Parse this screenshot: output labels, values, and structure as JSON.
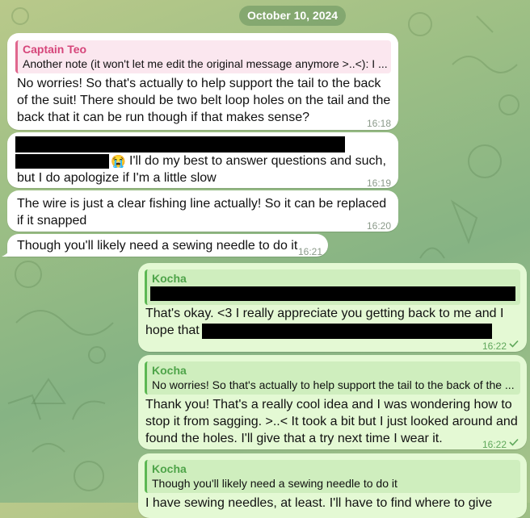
{
  "date_separator": "October 10, 2024",
  "messages": [
    {
      "sender": "incoming",
      "reply_to": {
        "name": "Captain Teo",
        "quote": "Another note (it won't let me edit the original message anymore >..<): I ..."
      },
      "lines": [
        "No worries! So that's actually to help support the tail to the back",
        "of the suit! There should be two belt loop holes on the tail and the",
        "back that it can be run though if that makes sense?"
      ],
      "time": "16:18"
    },
    {
      "sender": "incoming",
      "emoji": "😭",
      "lines": [
        "I'll do my best to answer questions and such,",
        "but I do apologize if I'm a little slow"
      ],
      "time": "16:19"
    },
    {
      "sender": "incoming",
      "lines": [
        "The wire is just a clear fishing line actually! So it can be replaced",
        "if it snapped"
      ],
      "time": "16:20"
    },
    {
      "sender": "incoming",
      "lines": [
        "Though you'll likely need a sewing needle to do it"
      ],
      "time": "16:21"
    },
    {
      "sender": "outgoing",
      "reply_to": {
        "name": "Kocha",
        "quote": ""
      },
      "lines": [
        "That's okay. <3 I really appreciate you getting back to me and I",
        "hope that"
      ],
      "time": "16:22"
    },
    {
      "sender": "outgoing",
      "reply_to": {
        "name": "Kocha",
        "quote": "No worries! So that's actually to help support the tail to the back of the ..."
      },
      "lines": [
        "Thank you! That's a really cool idea and I was wondering how to",
        "stop it from sagging. >..< It took a bit but I just looked around and",
        "found the holes. I'll give that a try next time I wear it."
      ],
      "time": "16:22"
    },
    {
      "sender": "outgoing",
      "reply_to": {
        "name": "Kocha",
        "quote": "Though you'll likely need a sewing needle to do it"
      },
      "lines": [
        "I have sewing needles, at least. I'll have to find where to give"
      ],
      "time": ""
    }
  ],
  "colors": {
    "incoming_bubble": "#ffffff",
    "outgoing_bubble": "#e4f9d4",
    "incoming_reply_accent": "#e0678e",
    "outgoing_reply_accent": "#5cb853",
    "date_chip": "#66925c"
  },
  "icons": {
    "read_receipt": "check-icon",
    "crying_emoji": "loudly-crying-face"
  }
}
